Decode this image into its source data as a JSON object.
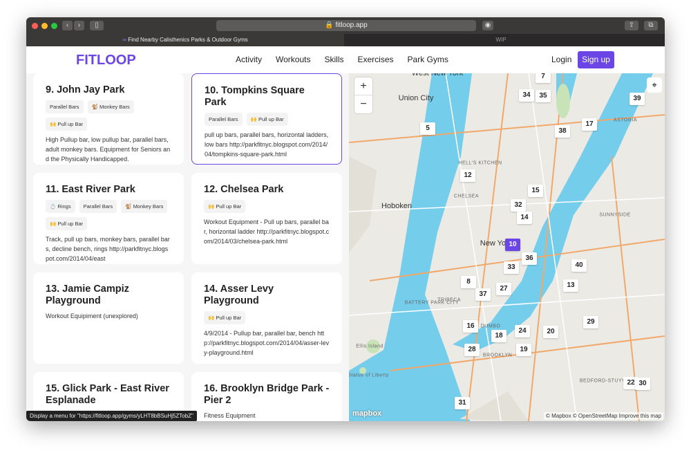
{
  "browser": {
    "url": "fitloop.app",
    "tabs": [
      "Find Nearby Calisthenics Parks & Outdoor Gyms",
      "WIP"
    ]
  },
  "header": {
    "logo": "FITLOOP",
    "nav": [
      "Activity",
      "Workouts",
      "Skills",
      "Exercises",
      "Park Gyms"
    ],
    "login": "Login",
    "signup": "Sign up"
  },
  "cards": [
    {
      "title": "9. John Jay Park",
      "tags": [
        "Parallel Bars",
        "🐒 Monkey Bars",
        "🙌 Pull up Bar"
      ],
      "desc": "High Pullup bar, low pullup bar, parallel bars, adult monkey bars. Equipment for Seniors and the Physically Handicapped."
    },
    {
      "title": "10. Tompkins Square Park",
      "tags": [
        "Parallel Bars",
        "🙌 Pull up Bar"
      ],
      "desc": "pull up bars, parallel bars, horizontal ladders, low bars http://parkfitnyc.blogspot.com/2014/04/tompkins-square-park.html"
    },
    {
      "title": "11. East River Park",
      "tags": [
        "💍 Rings",
        "Parallel Bars",
        "🐒 Monkey Bars",
        "🙌 Pull up Bar"
      ],
      "desc": "Track, pull up bars, monkey bars, parallel bars, decline bench, rings http://parkfitnyc.blogspot.com/2014/04/east"
    },
    {
      "title": "12. Chelsea Park",
      "tags": [
        "🙌 Pull up Bar"
      ],
      "desc": "Workout Equipment - Pull up bars, parallel bar, horizontal ladder http://parkfitnyc.blogspot.com/2014/03/chelsea-park.html"
    },
    {
      "title": "13. Jamie Campiz Playground",
      "tags": [],
      "desc": "Workout Equipiment (unexplored)"
    },
    {
      "title": "14. Asser Levy Playground",
      "tags": [
        "🙌 Pull up Bar"
      ],
      "desc": "4/9/2014 - Pullup bar, parallel bar, bench http://parkfitnyc.blogspot.com/2014/04/asser-levy-playground.html"
    },
    {
      "title": "15. Glick Park - East River Esplanade",
      "tags": [],
      "desc": ""
    },
    {
      "title": "16. Brooklyn Bridge Park - Pier 2",
      "tags": [],
      "desc": "Fitness Equipment"
    }
  ],
  "status_bar": "Display a menu for \"https://fitloop.app/gyms/yLHT8bBSuHj5ZTobZ\"",
  "map": {
    "markers": [
      "7",
      "34",
      "35",
      "39",
      "5",
      "38",
      "17",
      "12",
      "15",
      "32",
      "14",
      "10",
      "36",
      "33",
      "40",
      "8",
      "27",
      "37",
      "13",
      "29",
      "16",
      "24",
      "18",
      "20",
      "28",
      "19",
      "22",
      "30",
      "31"
    ],
    "selected_marker": "10",
    "labels": [
      "West New York",
      "Union City",
      "Hoboken",
      "New York",
      "CHELSEA",
      "HELL'S KITCHEN",
      "TRIBECA",
      "BATTERY PARK CITY",
      "Ellis Island",
      "Statue of Liberty",
      "DUMBO",
      "BROOKLYN",
      "ASTORIA",
      "SUNNYSIDE",
      "BEDFORD-STUYVESANT"
    ],
    "zoom_in": "+",
    "zoom_out": "−",
    "brand": "mapbox",
    "attribution": "© Mapbox © OpenStreetMap Improve this map"
  }
}
